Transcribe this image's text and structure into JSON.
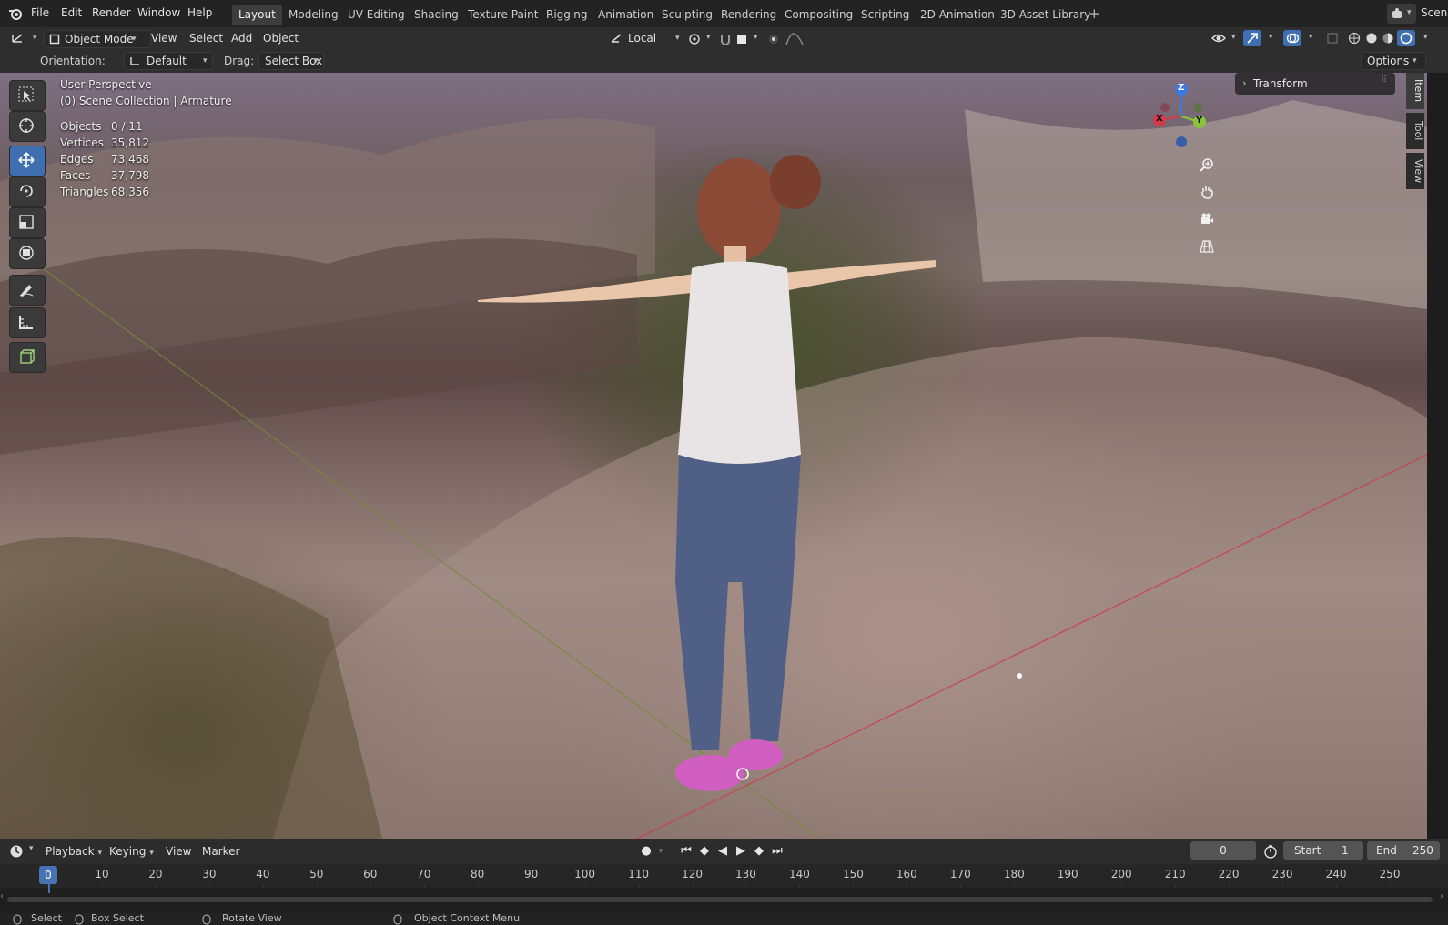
{
  "menubar": {
    "items": [
      "File",
      "Edit",
      "Render",
      "Window",
      "Help"
    ],
    "workspaces": [
      "Layout",
      "Modeling",
      "UV Editing",
      "Shading",
      "Texture Paint",
      "Rigging",
      "Animation",
      "Sculpting",
      "Rendering",
      "Compositing",
      "Scripting",
      "2D Animation",
      "3D Asset Library"
    ],
    "active_workspace": "Layout",
    "add_tab": "+",
    "scene": "Scene"
  },
  "header": {
    "mode": "Object Mode",
    "menus": [
      "View",
      "Select",
      "Add",
      "Object"
    ],
    "transform_orientation": "Local"
  },
  "tool_settings": {
    "orientation_label": "Orientation:",
    "orientation_value": "Default",
    "drag_label": "Drag:",
    "drag_value": "Select Box",
    "options": "Options"
  },
  "viewport": {
    "view_name": "User Perspective",
    "collection": "(0) Scene Collection | Armature",
    "stats": [
      {
        "label": "Objects",
        "value": "0 / 11"
      },
      {
        "label": "Vertices",
        "value": "35,812"
      },
      {
        "label": "Edges",
        "value": "73,468"
      },
      {
        "label": "Faces",
        "value": "37,798"
      },
      {
        "label": "Triangles",
        "value": "68,356"
      }
    ],
    "gizmo": {
      "x": "X",
      "y": "Y",
      "z": "Z"
    },
    "n_panel": {
      "transform": "Transform",
      "tabs": [
        "Item",
        "Tool",
        "View"
      ]
    }
  },
  "timeline": {
    "menus": [
      "Playback",
      "Keying",
      "View",
      "Marker"
    ],
    "current_frame": "0",
    "start_label": "Start",
    "start_value": "1",
    "end_label": "End",
    "end_value": "250",
    "ticks": [
      "0",
      "10",
      "20",
      "30",
      "40",
      "50",
      "60",
      "70",
      "80",
      "90",
      "100",
      "110",
      "120",
      "130",
      "140",
      "150",
      "160",
      "170",
      "180",
      "190",
      "200",
      "210",
      "220",
      "230",
      "240",
      "250"
    ]
  },
  "statusbar": {
    "select": "Select",
    "box_select": "Box Select",
    "rotate_view": "Rotate View",
    "context_menu": "Object Context Menu"
  },
  "colors": {
    "accent": "#4772b3",
    "x_axis": "#d33b4b",
    "y_axis": "#8ac43a",
    "z_axis": "#3d7ae0"
  }
}
